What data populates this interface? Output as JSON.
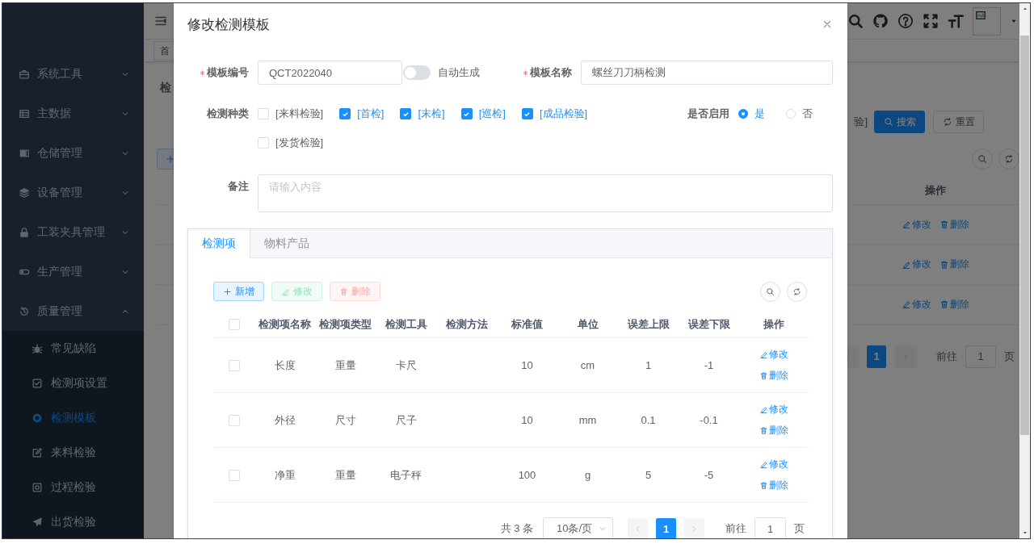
{
  "sidebar": {
    "items": [
      {
        "label": "系统工具",
        "expanded": false
      },
      {
        "label": "主数据",
        "expanded": false
      },
      {
        "label": "仓储管理",
        "expanded": false
      },
      {
        "label": "设备管理",
        "expanded": false
      },
      {
        "label": "工装夹具管理",
        "expanded": false
      },
      {
        "label": "生产管理",
        "expanded": false
      },
      {
        "label": "质量管理",
        "expanded": true,
        "children": [
          {
            "label": "常见缺陷",
            "selected": false
          },
          {
            "label": "检测项设置",
            "selected": false
          },
          {
            "label": "检测模板",
            "selected": true
          },
          {
            "label": "来料检验",
            "selected": false
          },
          {
            "label": "过程检验",
            "selected": false
          },
          {
            "label": "出货检验",
            "selected": false
          }
        ]
      }
    ]
  },
  "background": {
    "tags": [
      "首"
    ],
    "page_heading": "检",
    "search_form": {
      "field_text": "验]",
      "buttons": [
        {
          "kind": "search",
          "label": "搜索"
        },
        {
          "kind": "reset",
          "label": "重置"
        }
      ]
    },
    "table": {
      "columns": [
        "操作"
      ],
      "rows": [
        {
          "actions": [
            "修改",
            "删除"
          ]
        },
        {
          "actions": [
            "修改",
            "删除"
          ]
        },
        {
          "actions": [
            "修改",
            "删除"
          ]
        }
      ]
    },
    "pagination": {
      "pages": [
        {
          "label": "1",
          "selected": true
        }
      ],
      "jump_label": "前往",
      "jump_value": "1",
      "jump_suffix": "页"
    }
  },
  "dialog": {
    "title": "修改检测模板",
    "form": {
      "template_code": {
        "label": "模板编号",
        "required": true,
        "value": "QCT2022040"
      },
      "auto_generate": {
        "label": "自动生成",
        "on": false
      },
      "template_name": {
        "label": "模板名称",
        "required": true,
        "value": "螺丝刀刀柄检测"
      },
      "inspection_types": {
        "label": "检测种类",
        "options": [
          {
            "label": "[来料检验]",
            "checked": false
          },
          {
            "label": "[首检]",
            "checked": true
          },
          {
            "label": "[末检]",
            "checked": true
          },
          {
            "label": "[巡检]",
            "checked": true
          },
          {
            "label": "[成品检验]",
            "checked": true
          },
          {
            "label": "[发货检验]",
            "checked": false
          }
        ]
      },
      "enabled": {
        "label": "是否启用",
        "options": [
          {
            "label": "是",
            "selected": true
          },
          {
            "label": "否",
            "selected": false
          }
        ]
      },
      "remark": {
        "label": "备注",
        "placeholder": "请输入内容"
      }
    },
    "tabs": [
      {
        "label": "检测项",
        "selected": true
      },
      {
        "label": "物料产品",
        "selected": false
      }
    ],
    "toolbar": [
      {
        "kind": "add",
        "label": "新增",
        "disabled": false
      },
      {
        "kind": "edit",
        "label": "修改",
        "disabled": true
      },
      {
        "kind": "delete",
        "label": "删除",
        "disabled": true
      }
    ],
    "table": {
      "select_all": false,
      "columns": [
        "检测项名称",
        "检测项类型",
        "检测工具",
        "检测方法",
        "标准值",
        "单位",
        "误差上限",
        "误差下限",
        "操作"
      ],
      "rows": [
        {
          "checked": false,
          "name": "长度",
          "type": "重量",
          "tool": "卡尺",
          "standard": "10",
          "unit": "cm",
          "upper": "1",
          "lower": "-1",
          "actions": [
            "修改",
            "删除"
          ]
        },
        {
          "checked": false,
          "name": "外径",
          "type": "尺寸",
          "tool": "尺子",
          "standard": "10",
          "unit": "mm",
          "upper": "0.1",
          "lower": "-0.1",
          "actions": [
            "修改",
            "删除"
          ]
        },
        {
          "checked": false,
          "name": "净重",
          "type": "重量",
          "tool": "电子秤",
          "standard": "100",
          "unit": "g",
          "upper": "5",
          "lower": "-5",
          "actions": [
            "修改",
            "删除"
          ]
        }
      ]
    },
    "pagination": {
      "total": "共 3 条",
      "page_size": "10条/页",
      "pages": [
        {
          "label": "1",
          "selected": true
        }
      ],
      "jump_label": "前往",
      "jump_value": "1",
      "jump_suffix": "页"
    }
  }
}
